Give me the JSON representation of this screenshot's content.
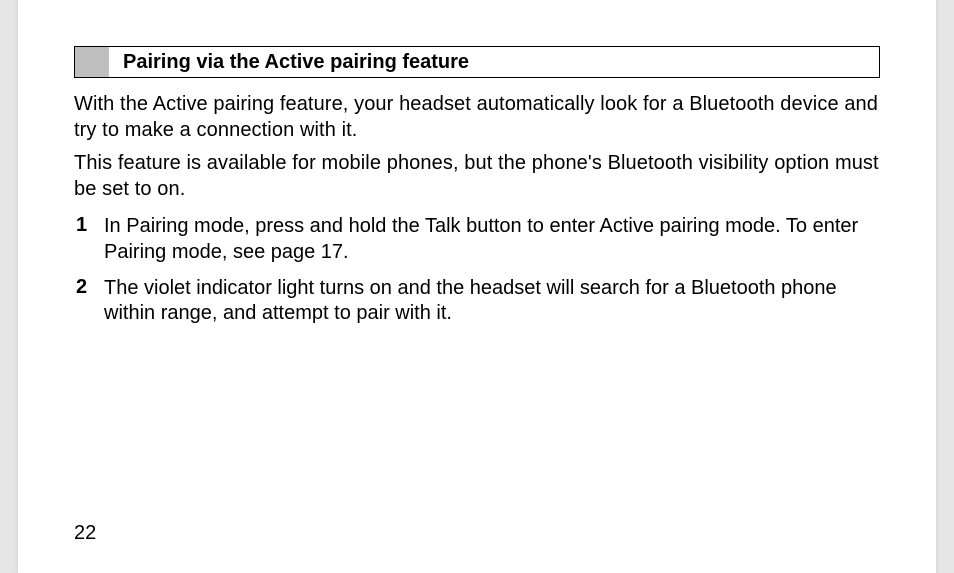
{
  "heading": "Pairing via the Active pairing feature",
  "paragraphs": {
    "p1": "With the Active pairing feature, your headset automatically look for a Bluetooth device and try to make a connection with it.",
    "p2": "This feature is available for mobile phones, but the phone's Bluetooth visibility option must be set to on."
  },
  "steps": [
    {
      "num": "1",
      "text": "In Pairing mode, press and hold the Talk button to enter Active pairing mode. To enter Pairing mode, see page 17."
    },
    {
      "num": "2",
      "text": "The violet indicator light turns on and the headset will search for a Bluetooth phone within range, and attempt to pair with it."
    }
  ],
  "page_number": "22"
}
